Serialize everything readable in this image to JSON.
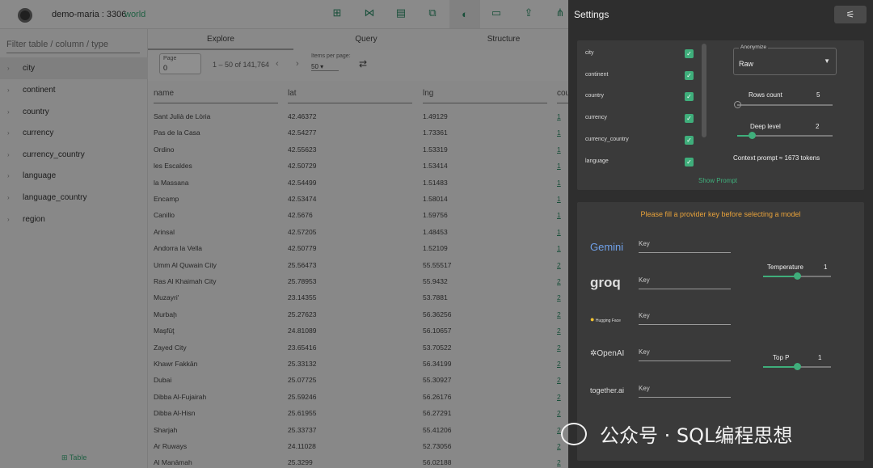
{
  "header": {
    "connection": "demo-maria : 3306",
    "database": "world",
    "tools": [
      "table-plus-icon",
      "relations-icon",
      "bookmark-icon",
      "copy-icon",
      "ai-brain-icon",
      "window-icon",
      "export-icon",
      "share-icon"
    ]
  },
  "sidebar": {
    "filter_placeholder": "Filter table / column / type",
    "tables": [
      "city",
      "continent",
      "country",
      "currency",
      "currency_country",
      "language",
      "language_country",
      "region"
    ],
    "add_table": "Table"
  },
  "tabs": [
    "Explore",
    "Query",
    "Structure"
  ],
  "pager": {
    "page_label": "Page",
    "page_value": "0",
    "range": "1 – 50 of 141,764",
    "items_label": "Items per page:",
    "items_value": "50"
  },
  "grid": {
    "columns": [
      "name",
      "lat",
      "lng",
      "cou"
    ],
    "rows": [
      [
        "Sant Julià de Lòria",
        "42.46372",
        "1.49129",
        "1"
      ],
      [
        "Pas de la Casa",
        "42.54277",
        "1.73361",
        "1"
      ],
      [
        "Ordino",
        "42.55623",
        "1.53319",
        "1"
      ],
      [
        "les Escaldes",
        "42.50729",
        "1.53414",
        "1"
      ],
      [
        "la Massana",
        "42.54499",
        "1.51483",
        "1"
      ],
      [
        "Encamp",
        "42.53474",
        "1.58014",
        "1"
      ],
      [
        "Canillo",
        "42.5676",
        "1.59756",
        "1"
      ],
      [
        "Arinsal",
        "42.57205",
        "1.48453",
        "1"
      ],
      [
        "Andorra la Vella",
        "42.50779",
        "1.52109",
        "1"
      ],
      [
        "Umm Al Quwain City",
        "25.56473",
        "55.55517",
        "2"
      ],
      [
        "Ras Al Khaimah City",
        "25.78953",
        "55.9432",
        "2"
      ],
      [
        "Muzayri'",
        "23.14355",
        "53.7881",
        "2"
      ],
      [
        "Murbaḩ",
        "25.27623",
        "56.36256",
        "2"
      ],
      [
        "Maşfūţ",
        "24.81089",
        "56.10657",
        "2"
      ],
      [
        "Zayed City",
        "23.65416",
        "53.70522",
        "2"
      ],
      [
        "Khawr Fakkān",
        "25.33132",
        "56.34199",
        "2"
      ],
      [
        "Dubai",
        "25.07725",
        "55.30927",
        "2"
      ],
      [
        "Dibba Al-Fujairah",
        "25.59246",
        "56.26176",
        "2"
      ],
      [
        "Dibba Al-Hisn",
        "25.61955",
        "56.27291",
        "2"
      ],
      [
        "Sharjah",
        "25.33737",
        "55.41206",
        "2"
      ],
      [
        "Ar Ruways",
        "24.11028",
        "52.73056",
        "2"
      ],
      [
        "Al Manāmah",
        "25.3299",
        "56.02188",
        "2"
      ]
    ]
  },
  "settings": {
    "title": "Settings",
    "columns": [
      {
        "label": "city",
        "checked": true
      },
      {
        "label": "continent",
        "checked": true
      },
      {
        "label": "country",
        "checked": true
      },
      {
        "label": "currency",
        "checked": true
      },
      {
        "label": "currency_country",
        "checked": true
      },
      {
        "label": "language",
        "checked": true
      }
    ],
    "anonymize_label": "Anonymize",
    "anonymize_value": "Raw",
    "rows_count_label": "Rows count",
    "rows_count_value": "5",
    "rows_count_fraction": 0.0,
    "deep_level_label": "Deep level",
    "deep_level_value": "2",
    "deep_level_fraction": 0.15,
    "context_prompt": "Context prompt ≈ 1673 tokens",
    "show_prompt": "Show Prompt",
    "provider_warning": "Please fill a provider key before selecting a model",
    "providers": [
      "Gemini",
      "groq",
      "Hugging Face",
      "OpenAI",
      "together.ai"
    ],
    "key_placeholder": "Key",
    "temperature_label": "Temperature",
    "temperature_value": "1",
    "temperature_fraction": 0.5,
    "top_p_label": "Top P",
    "top_p_value": "1",
    "top_p_fraction": 0.5,
    "accent": "#3fae7b",
    "warning_color": "#e8a23a"
  },
  "watermark": "公众号 · SQL编程思想"
}
